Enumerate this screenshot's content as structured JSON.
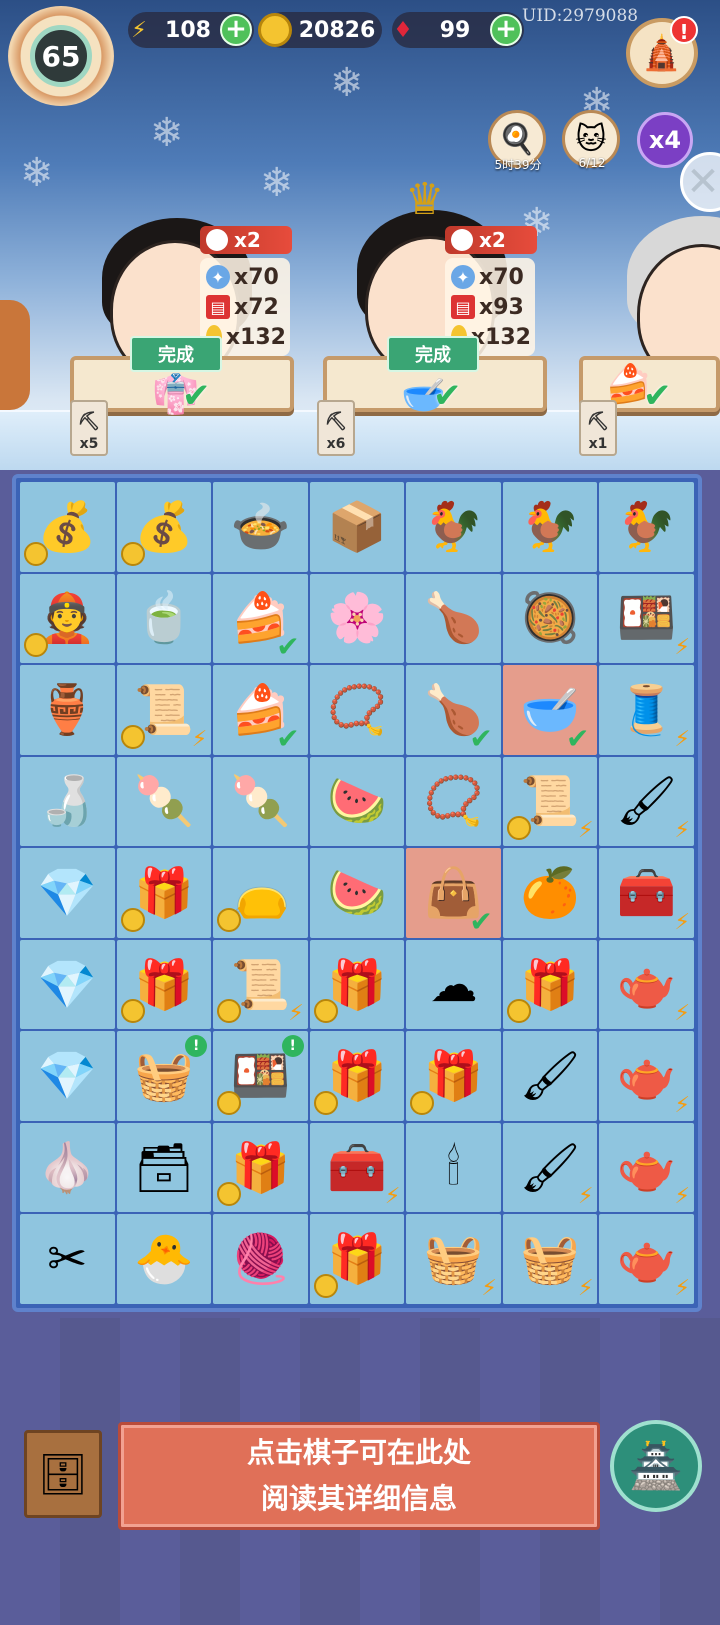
{
  "hud": {
    "level": "65",
    "energy": "108",
    "coins": "20826",
    "gems": "99",
    "uid": "UID:2979088",
    "shop_alert": "!",
    "cooking_timer": "5时39分",
    "cat_count": "6/12",
    "multiplier": "x4"
  },
  "customers": [
    {
      "cat_bonus": "x2",
      "xp": "x70",
      "tickets": "x72",
      "coins": "x132",
      "done_label": "完成",
      "shovel_count": "x5"
    },
    {
      "cat_bonus": "x2",
      "xp": "x70",
      "tickets": "x93",
      "coins": "x132",
      "done_label": "完成",
      "shovel_count": "x6"
    },
    {
      "shovel_count": "x1"
    }
  ],
  "board": {
    "rows": [
      [
        {
          "icon": "💰",
          "coin": true
        },
        {
          "icon": "💰",
          "coin": true
        },
        {
          "icon": "🍲"
        },
        {
          "icon": "📦"
        },
        {
          "icon": "🐓"
        },
        {
          "icon": "🐓"
        },
        {
          "icon": "🐓"
        }
      ],
      [
        {
          "icon": "👲",
          "coin": true
        },
        {
          "icon": "🍵"
        },
        {
          "icon": "🍰",
          "check": true
        },
        {
          "icon": "🌸"
        },
        {
          "icon": "🍗"
        },
        {
          "icon": "🥘"
        },
        {
          "icon": "🍱",
          "bolt": true
        }
      ],
      [
        {
          "icon": "🏺"
        },
        {
          "icon": "📜",
          "coin": true,
          "bolt": true
        },
        {
          "icon": "🍰",
          "check": true
        },
        {
          "icon": "📿"
        },
        {
          "icon": "🍗",
          "check": true
        },
        {
          "icon": "🥣",
          "check": true,
          "highlight": true
        },
        {
          "icon": "🧵",
          "bolt": true
        }
      ],
      [
        {
          "icon": "🍶"
        },
        {
          "icon": "🍡"
        },
        {
          "icon": "🍡"
        },
        {
          "icon": "🍉"
        },
        {
          "icon": "📿"
        },
        {
          "icon": "📜",
          "coin": true,
          "bolt": true
        },
        {
          "icon": "🖌",
          "bolt": true
        }
      ],
      [
        {
          "icon": "💎"
        },
        {
          "icon": "🎁",
          "coin": true
        },
        {
          "icon": "👝",
          "coin": true
        },
        {
          "icon": "🍉"
        },
        {
          "icon": "👜",
          "check": true,
          "highlight": true
        },
        {
          "icon": "🍊"
        },
        {
          "icon": "🧰",
          "bolt": true
        }
      ],
      [
        {
          "icon": "💎"
        },
        {
          "icon": "🎁",
          "coin": true
        },
        {
          "icon": "📜",
          "coin": true,
          "bolt": true
        },
        {
          "icon": "🎁",
          "coin": true
        },
        {
          "icon": "☁"
        },
        {
          "icon": "🎁",
          "coin": true
        },
        {
          "icon": "🫖",
          "bolt": true
        }
      ],
      [
        {
          "icon": "💎"
        },
        {
          "icon": "🧺",
          "excl": true
        },
        {
          "icon": "🍱",
          "coin": true,
          "excl": true
        },
        {
          "icon": "🎁",
          "coin": true
        },
        {
          "icon": "🎁",
          "coin": true
        },
        {
          "icon": "🖌"
        },
        {
          "icon": "🫖",
          "bolt": true
        }
      ],
      [
        {
          "icon": "🧄"
        },
        {
          "icon": "🗃"
        },
        {
          "icon": "🎁",
          "coin": true
        },
        {
          "icon": "🧰",
          "bolt": true
        },
        {
          "icon": "🕯"
        },
        {
          "icon": "🖌",
          "bolt": true
        },
        {
          "icon": "🫖",
          "bolt": true
        }
      ],
      [
        {
          "icon": "✂"
        },
        {
          "icon": "🐣"
        },
        {
          "icon": "🧶"
        },
        {
          "icon": "🎁",
          "coin": true
        },
        {
          "icon": "🧺",
          "bolt": true
        },
        {
          "icon": "🧺",
          "bolt": true
        },
        {
          "icon": "🫖",
          "bolt": true
        }
      ]
    ]
  },
  "footer": {
    "info_line1": "点击棋子可在此处",
    "info_line2": "阅读其详细信息"
  },
  "colors": {
    "board_bg": "#3b63b6",
    "cell_bg": "#8fc5df",
    "cell_highlight": "#e59d8c",
    "done_green": "#3aa574",
    "info_red": "#e07058",
    "footer_purple": "#5a5d9a"
  }
}
